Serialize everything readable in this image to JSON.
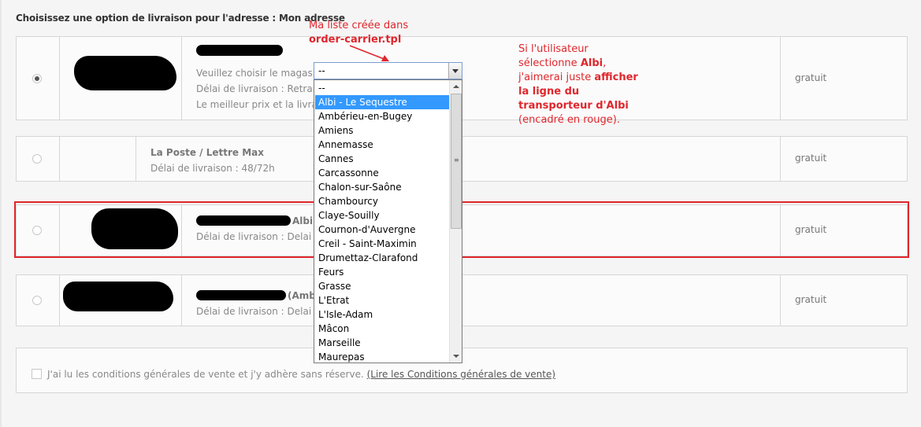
{
  "page": {
    "title": "Choisissez une option de livraison pour l'adresse : Mon adresse"
  },
  "carriers": [
    {
      "selected": true,
      "name": "",
      "select_prompt": "Veuillez choisir le magasin :",
      "delay": "Délai de livraison : Retrait e",
      "best": "Le meilleur prix et la livraiso",
      "price": "gratuit"
    },
    {
      "selected": false,
      "name": "La Poste / Lettre Max",
      "delay": "Délai de livraison : 48/72h",
      "price": "gratuit"
    },
    {
      "selected": false,
      "name": "Albi",
      "delay": "Délai de livraison : Delai XX",
      "price": "gratuit"
    },
    {
      "selected": false,
      "name": "(Ambe",
      "delay": "Délai de livraison : Delai XX",
      "price": "gratuit"
    }
  ],
  "store_select": {
    "current_value": "--",
    "options": [
      "--",
      "Albi - Le Sequestre",
      "Ambérieu-en-Bugey",
      "Amiens",
      "Annemasse",
      "Cannes",
      "Carcassonne",
      "Chalon-sur-Saône",
      "Chambourcy",
      "Claye-Souilly",
      "Cournon-d'Auvergne",
      "Creil - Saint-Maximin",
      "Drumettaz-Clarafond",
      "Feurs",
      "Grasse",
      "L'Etrat",
      "L'Isle-Adam",
      "Mâcon",
      "Marseille",
      "Maurepas"
    ],
    "highlighted_index": 1
  },
  "annotations": {
    "list_note_line1": "Ma liste créée dans",
    "list_note_line2": "order-carrier.tpl",
    "right_note": {
      "l1a": "Si l'utilisateur",
      "l2a": "sélectionne ",
      "l2b": "Albi",
      "l2c": ",",
      "l3a": "j'aimerai juste ",
      "l3b": "afficher",
      "l4": "la ligne du",
      "l5": "transporteur d'Albi",
      "l6": "(encadré en rouge)."
    },
    "accent_color": "#e0262c"
  },
  "cgv": {
    "text": "J'ai lu les conditions générales de vente et j'y adhère sans réserve.",
    "link": "(Lire les Conditions générales de vente)"
  }
}
